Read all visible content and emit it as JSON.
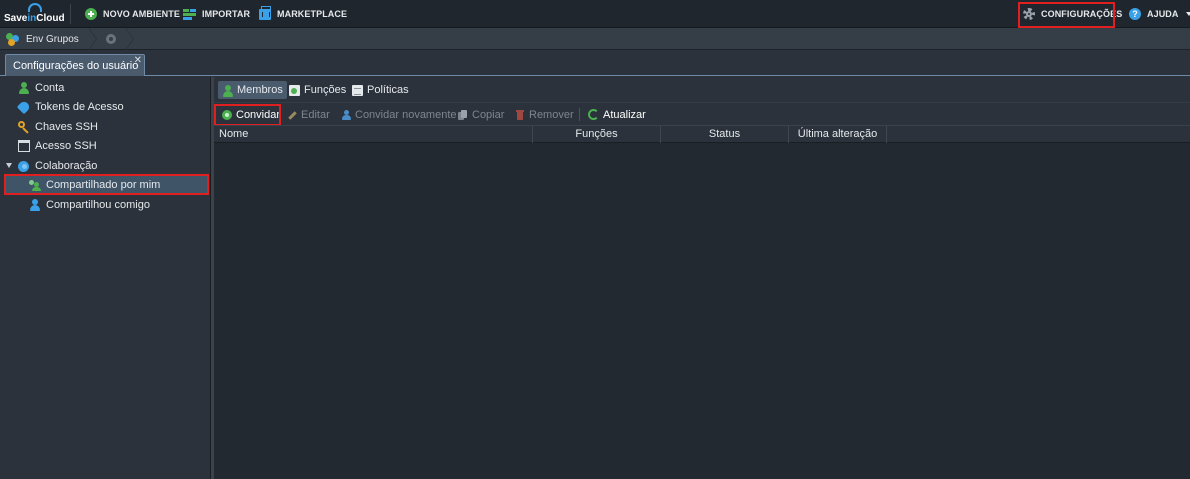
{
  "app": {
    "logo_text_pre": "Save",
    "logo_text_mid": "in",
    "logo_text_post": "Cloud"
  },
  "topbar": {
    "new_env_label": "NOVO AMBIENTE",
    "import_label": "IMPORTAR",
    "marketplace_label": "MARKETPLACE",
    "settings_label": "CONFIGURAÇÕES",
    "help_label": "AJUDA"
  },
  "breadcrumb": {
    "env_groups_label": "Env Grupos"
  },
  "panel": {
    "tab_label": "Configurações do usuário",
    "close_glyph": "✕"
  },
  "sidebar": {
    "items": [
      {
        "label": "Conta"
      },
      {
        "label": "Tokens de Acesso"
      },
      {
        "label": "Chaves SSH"
      },
      {
        "label": "Acesso SSH"
      },
      {
        "label": "Colaboração"
      },
      {
        "label": "Compartilhado por mim"
      },
      {
        "label": "Compartilhou comigo"
      }
    ],
    "selected": "Compartilhado por mim"
  },
  "main": {
    "tabs": [
      {
        "label": "Membros"
      },
      {
        "label": "Funções"
      },
      {
        "label": "Políticas"
      }
    ],
    "toolbar": {
      "invite": "Convidar",
      "edit": "Editar",
      "reinvite": "Convidar novamente",
      "copy": "Copiar",
      "remove": "Remover",
      "refresh": "Atualizar"
    },
    "columns": [
      "Nome",
      "Funções",
      "Status",
      "Última alteração"
    ]
  },
  "colors": {
    "highlight": "#e02020",
    "accent": "#3aa0e8",
    "green": "#4caf50"
  }
}
